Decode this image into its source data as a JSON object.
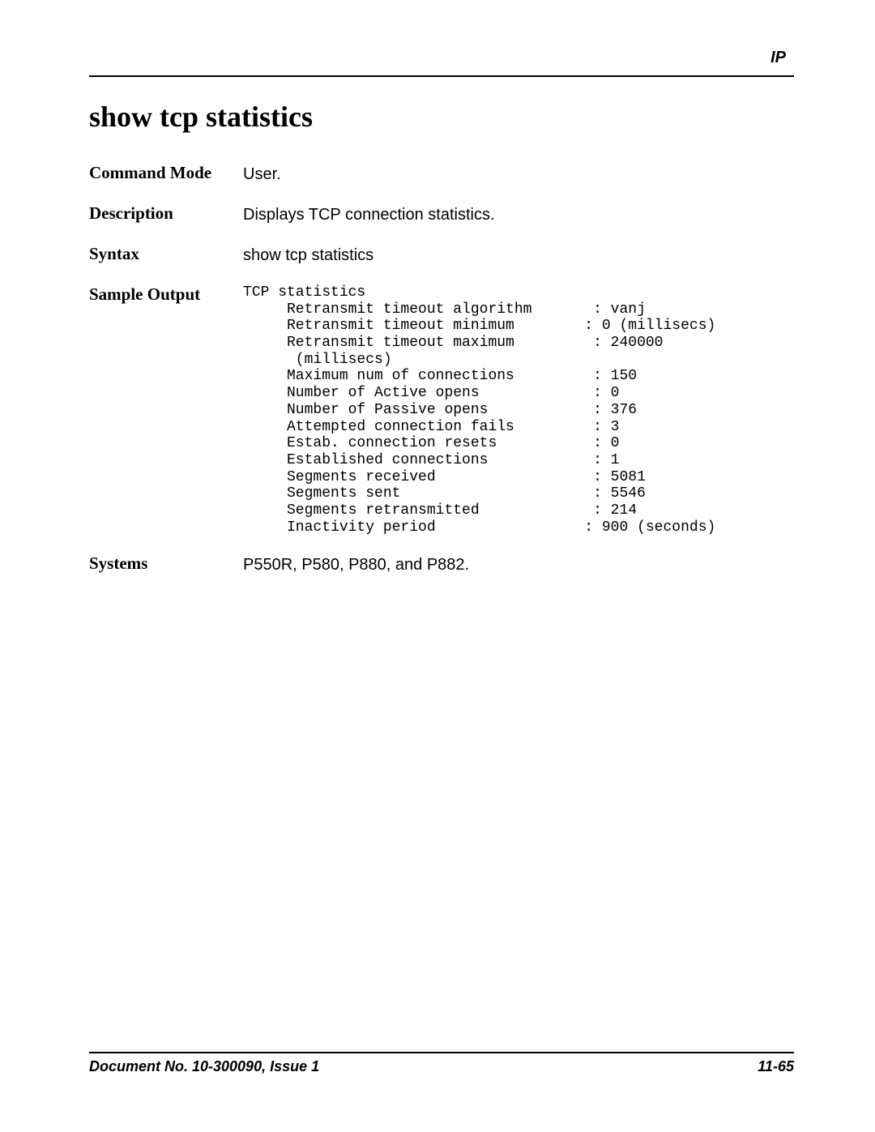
{
  "header": {
    "section_label": "IP"
  },
  "title": "show tcp statistics",
  "sections": {
    "command_mode": {
      "label": "Command Mode",
      "value": "User."
    },
    "description": {
      "label": "Description",
      "value": "Displays TCP connection statistics."
    },
    "syntax": {
      "label": "Syntax",
      "value": "show tcp statistics"
    },
    "sample_output": {
      "label": "Sample Output",
      "value": "TCP statistics\n     Retransmit timeout algorithm       : vanj\n     Retransmit timeout minimum        : 0 (millisecs)\n     Retransmit timeout maximum         : 240000\n      (millisecs)\n     Maximum num of connections         : 150\n     Number of Active opens             : 0\n     Number of Passive opens            : 376\n     Attempted connection fails         : 3\n     Estab. connection resets           : 0\n     Established connections            : 1\n     Segments received                  : 5081\n     Segments sent                      : 5546\n     Segments retransmitted             : 214\n     Inactivity period                 : 900 (seconds)"
    },
    "systems": {
      "label": "Systems",
      "value": "P550R, P580, P880, and P882."
    }
  },
  "footer": {
    "doc": "Document No. 10-300090, Issue 1",
    "page": "11-65"
  }
}
